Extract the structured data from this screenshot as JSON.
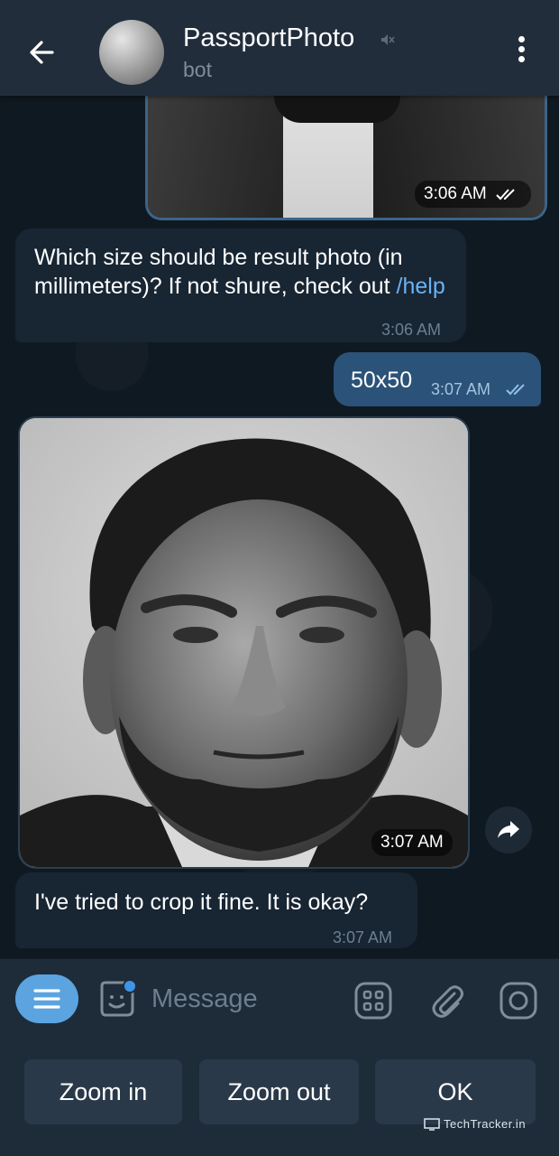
{
  "header": {
    "title": "PassportPhoto",
    "subtitle": "bot"
  },
  "messages": {
    "photo_top_time": "3:06 AM",
    "bot_question": {
      "text": "Which size should be result photo (in millimeters)? If not shure, check out ",
      "link": "/help",
      "time": "3:06 AM"
    },
    "user_reply": {
      "text": "50x50",
      "time": "3:07 AM"
    },
    "photo_main_time": "3:07 AM",
    "bot_confirm": {
      "text": "I've tried to crop it fine. It is okay?",
      "time": "3:07 AM"
    }
  },
  "input": {
    "placeholder": "Message"
  },
  "keyboard": {
    "buttons": [
      "Zoom in",
      "Zoom out",
      "OK"
    ]
  },
  "watermark": "TechTracker.in",
  "colors": {
    "header_bg": "#212d3b",
    "chat_bg": "#0f1922",
    "bubble_in": "#182533",
    "bubble_out": "#2b5278",
    "accent": "#5ba4e0",
    "link": "#6ab3f3"
  }
}
